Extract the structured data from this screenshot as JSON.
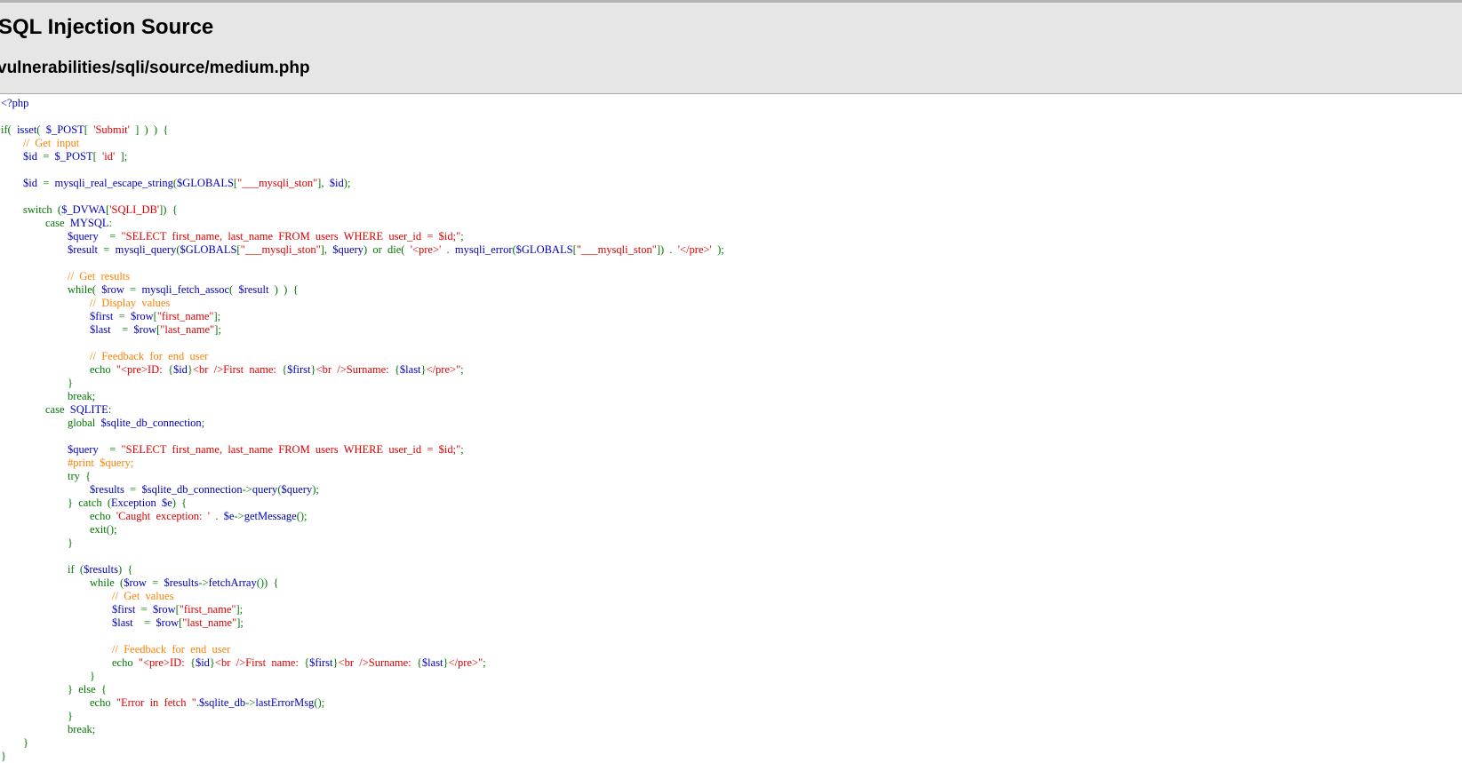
{
  "header": {
    "title": "SQL Injection Source",
    "subtitle": "vulnerabilities/sqli/source/medium.php"
  },
  "colors": {
    "header_bg": "#e6e6e6",
    "keyword": "#007700",
    "default": "#0000bb",
    "string": "#dd0000",
    "comment": "#ff8000"
  },
  "code_lines": [
    [
      {
        "t": "html",
        "v": "<?php"
      }
    ],
    [],
    [
      {
        "t": "keyword",
        "v": "if(  "
      },
      {
        "t": "default",
        "v": "isset"
      },
      {
        "t": "keyword",
        "v": "(  "
      },
      {
        "t": "default",
        "v": "$_POST"
      },
      {
        "t": "keyword",
        "v": "[  "
      },
      {
        "t": "string",
        "v": "'Submit'"
      },
      {
        "t": "keyword",
        "v": "  ]  )  )  {"
      }
    ],
    [
      {
        "t": "keyword",
        "v": "        "
      },
      {
        "t": "comment",
        "v": "//  Get  input"
      }
    ],
    [
      {
        "t": "keyword",
        "v": "        "
      },
      {
        "t": "default",
        "v": "$id  "
      },
      {
        "t": "keyword",
        "v": "=  "
      },
      {
        "t": "default",
        "v": "$_POST"
      },
      {
        "t": "keyword",
        "v": "[  "
      },
      {
        "t": "string",
        "v": "'id'"
      },
      {
        "t": "keyword",
        "v": "  ];"
      }
    ],
    [],
    [
      {
        "t": "keyword",
        "v": "        "
      },
      {
        "t": "default",
        "v": "$id  "
      },
      {
        "t": "keyword",
        "v": "=  "
      },
      {
        "t": "default",
        "v": "mysqli_real_escape_string"
      },
      {
        "t": "keyword",
        "v": "("
      },
      {
        "t": "default",
        "v": "$GLOBALS"
      },
      {
        "t": "keyword",
        "v": "["
      },
      {
        "t": "string",
        "v": "\"___mysqli_ston\""
      },
      {
        "t": "keyword",
        "v": "],  "
      },
      {
        "t": "default",
        "v": "$id"
      },
      {
        "t": "keyword",
        "v": ");"
      }
    ],
    [],
    [
      {
        "t": "keyword",
        "v": "        switch  ("
      },
      {
        "t": "default",
        "v": "$_DVWA"
      },
      {
        "t": "keyword",
        "v": "["
      },
      {
        "t": "string",
        "v": "'SQLI_DB'"
      },
      {
        "t": "keyword",
        "v": "])  {"
      }
    ],
    [
      {
        "t": "keyword",
        "v": "                case  "
      },
      {
        "t": "default",
        "v": "MYSQL"
      },
      {
        "t": "keyword",
        "v": ":"
      }
    ],
    [
      {
        "t": "keyword",
        "v": "                        "
      },
      {
        "t": "default",
        "v": "$query    "
      },
      {
        "t": "keyword",
        "v": "=  "
      },
      {
        "t": "string",
        "v": "\"SELECT  first_name,  last_name  FROM  users  WHERE  user_id  =  $id;\""
      },
      {
        "t": "keyword",
        "v": ";"
      }
    ],
    [
      {
        "t": "keyword",
        "v": "                        "
      },
      {
        "t": "default",
        "v": "$result  "
      },
      {
        "t": "keyword",
        "v": "=  "
      },
      {
        "t": "default",
        "v": "mysqli_query"
      },
      {
        "t": "keyword",
        "v": "("
      },
      {
        "t": "default",
        "v": "$GLOBALS"
      },
      {
        "t": "keyword",
        "v": "["
      },
      {
        "t": "string",
        "v": "\"___mysqli_ston\""
      },
      {
        "t": "keyword",
        "v": "],  "
      },
      {
        "t": "default",
        "v": "$query"
      },
      {
        "t": "keyword",
        "v": ")  or  die(  "
      },
      {
        "t": "string",
        "v": "'<pre>'  "
      },
      {
        "t": "keyword",
        "v": ".  "
      },
      {
        "t": "default",
        "v": "mysqli_error"
      },
      {
        "t": "keyword",
        "v": "("
      },
      {
        "t": "default",
        "v": "$GLOBALS"
      },
      {
        "t": "keyword",
        "v": "["
      },
      {
        "t": "string",
        "v": "\"___mysqli_ston\""
      },
      {
        "t": "keyword",
        "v": "])  .  "
      },
      {
        "t": "string",
        "v": "'</pre>'"
      },
      {
        "t": "keyword",
        "v": "  );"
      }
    ],
    [],
    [
      {
        "t": "keyword",
        "v": "                        "
      },
      {
        "t": "comment",
        "v": "//  Get  results"
      }
    ],
    [
      {
        "t": "keyword",
        "v": "                        while(  "
      },
      {
        "t": "default",
        "v": "$row  "
      },
      {
        "t": "keyword",
        "v": "=  "
      },
      {
        "t": "default",
        "v": "mysqli_fetch_assoc"
      },
      {
        "t": "keyword",
        "v": "(  "
      },
      {
        "t": "default",
        "v": "$result  "
      },
      {
        "t": "keyword",
        "v": ")  )  {"
      }
    ],
    [
      {
        "t": "keyword",
        "v": "                                "
      },
      {
        "t": "comment",
        "v": "//  Display  values"
      }
    ],
    [
      {
        "t": "keyword",
        "v": "                                "
      },
      {
        "t": "default",
        "v": "$first  "
      },
      {
        "t": "keyword",
        "v": "=  "
      },
      {
        "t": "default",
        "v": "$row"
      },
      {
        "t": "keyword",
        "v": "["
      },
      {
        "t": "string",
        "v": "\"first_name\""
      },
      {
        "t": "keyword",
        "v": "];"
      }
    ],
    [
      {
        "t": "keyword",
        "v": "                                "
      },
      {
        "t": "default",
        "v": "$last    "
      },
      {
        "t": "keyword",
        "v": "=  "
      },
      {
        "t": "default",
        "v": "$row"
      },
      {
        "t": "keyword",
        "v": "["
      },
      {
        "t": "string",
        "v": "\"last_name\""
      },
      {
        "t": "keyword",
        "v": "];"
      }
    ],
    [],
    [
      {
        "t": "keyword",
        "v": "                                "
      },
      {
        "t": "comment",
        "v": "//  Feedback  for  end  user"
      }
    ],
    [
      {
        "t": "keyword",
        "v": "                                echo  "
      },
      {
        "t": "string",
        "v": "\"<pre>ID:  "
      },
      {
        "t": "keyword",
        "v": "{"
      },
      {
        "t": "default",
        "v": "$id"
      },
      {
        "t": "keyword",
        "v": "}"
      },
      {
        "t": "string",
        "v": "<br  />First  name:  "
      },
      {
        "t": "keyword",
        "v": "{"
      },
      {
        "t": "default",
        "v": "$first"
      },
      {
        "t": "keyword",
        "v": "}"
      },
      {
        "t": "string",
        "v": "<br  />Surname:  "
      },
      {
        "t": "keyword",
        "v": "{"
      },
      {
        "t": "default",
        "v": "$last"
      },
      {
        "t": "keyword",
        "v": "}"
      },
      {
        "t": "string",
        "v": "</pre>\""
      },
      {
        "t": "keyword",
        "v": ";"
      }
    ],
    [
      {
        "t": "keyword",
        "v": "                        }"
      }
    ],
    [
      {
        "t": "keyword",
        "v": "                        break;"
      }
    ],
    [
      {
        "t": "keyword",
        "v": "                case  "
      },
      {
        "t": "default",
        "v": "SQLITE"
      },
      {
        "t": "keyword",
        "v": ":"
      }
    ],
    [
      {
        "t": "keyword",
        "v": "                        global  "
      },
      {
        "t": "default",
        "v": "$sqlite_db_connection"
      },
      {
        "t": "keyword",
        "v": ";"
      }
    ],
    [],
    [
      {
        "t": "keyword",
        "v": "                        "
      },
      {
        "t": "default",
        "v": "$query    "
      },
      {
        "t": "keyword",
        "v": "=  "
      },
      {
        "t": "string",
        "v": "\"SELECT  first_name,  last_name  FROM  users  WHERE  user_id  =  $id;\""
      },
      {
        "t": "keyword",
        "v": ";"
      }
    ],
    [
      {
        "t": "keyword",
        "v": "                        "
      },
      {
        "t": "comment",
        "v": "#print  $query;"
      }
    ],
    [
      {
        "t": "keyword",
        "v": "                        try  {"
      }
    ],
    [
      {
        "t": "keyword",
        "v": "                                "
      },
      {
        "t": "default",
        "v": "$results  "
      },
      {
        "t": "keyword",
        "v": "=  "
      },
      {
        "t": "default",
        "v": "$sqlite_db_connection"
      },
      {
        "t": "keyword",
        "v": "->"
      },
      {
        "t": "default",
        "v": "query"
      },
      {
        "t": "keyword",
        "v": "("
      },
      {
        "t": "default",
        "v": "$query"
      },
      {
        "t": "keyword",
        "v": ");"
      }
    ],
    [
      {
        "t": "keyword",
        "v": "                        }  catch  ("
      },
      {
        "t": "default",
        "v": "Exception  $e"
      },
      {
        "t": "keyword",
        "v": ")  {"
      }
    ],
    [
      {
        "t": "keyword",
        "v": "                                echo  "
      },
      {
        "t": "string",
        "v": "'Caught  exception:  '  "
      },
      {
        "t": "keyword",
        "v": ".  "
      },
      {
        "t": "default",
        "v": "$e"
      },
      {
        "t": "keyword",
        "v": "->"
      },
      {
        "t": "default",
        "v": "getMessage"
      },
      {
        "t": "keyword",
        "v": "();"
      }
    ],
    [
      {
        "t": "keyword",
        "v": "                                exit();"
      }
    ],
    [
      {
        "t": "keyword",
        "v": "                        }"
      }
    ],
    [],
    [
      {
        "t": "keyword",
        "v": "                        if  ("
      },
      {
        "t": "default",
        "v": "$results"
      },
      {
        "t": "keyword",
        "v": ")  {"
      }
    ],
    [
      {
        "t": "keyword",
        "v": "                                while  ("
      },
      {
        "t": "default",
        "v": "$row  "
      },
      {
        "t": "keyword",
        "v": "=  "
      },
      {
        "t": "default",
        "v": "$results"
      },
      {
        "t": "keyword",
        "v": "->"
      },
      {
        "t": "default",
        "v": "fetchArray"
      },
      {
        "t": "keyword",
        "v": "())  {"
      }
    ],
    [
      {
        "t": "keyword",
        "v": "                                        "
      },
      {
        "t": "comment",
        "v": "//  Get  values"
      }
    ],
    [
      {
        "t": "keyword",
        "v": "                                        "
      },
      {
        "t": "default",
        "v": "$first  "
      },
      {
        "t": "keyword",
        "v": "=  "
      },
      {
        "t": "default",
        "v": "$row"
      },
      {
        "t": "keyword",
        "v": "["
      },
      {
        "t": "string",
        "v": "\"first_name\""
      },
      {
        "t": "keyword",
        "v": "];"
      }
    ],
    [
      {
        "t": "keyword",
        "v": "                                        "
      },
      {
        "t": "default",
        "v": "$last    "
      },
      {
        "t": "keyword",
        "v": "=  "
      },
      {
        "t": "default",
        "v": "$row"
      },
      {
        "t": "keyword",
        "v": "["
      },
      {
        "t": "string",
        "v": "\"last_name\""
      },
      {
        "t": "keyword",
        "v": "];"
      }
    ],
    [],
    [
      {
        "t": "keyword",
        "v": "                                        "
      },
      {
        "t": "comment",
        "v": "//  Feedback  for  end  user"
      }
    ],
    [
      {
        "t": "keyword",
        "v": "                                        echo  "
      },
      {
        "t": "string",
        "v": "\"<pre>ID:  "
      },
      {
        "t": "keyword",
        "v": "{"
      },
      {
        "t": "default",
        "v": "$id"
      },
      {
        "t": "keyword",
        "v": "}"
      },
      {
        "t": "string",
        "v": "<br  />First  name:  "
      },
      {
        "t": "keyword",
        "v": "{"
      },
      {
        "t": "default",
        "v": "$first"
      },
      {
        "t": "keyword",
        "v": "}"
      },
      {
        "t": "string",
        "v": "<br  />Surname:  "
      },
      {
        "t": "keyword",
        "v": "{"
      },
      {
        "t": "default",
        "v": "$last"
      },
      {
        "t": "keyword",
        "v": "}"
      },
      {
        "t": "string",
        "v": "</pre>\""
      },
      {
        "t": "keyword",
        "v": ";"
      }
    ],
    [
      {
        "t": "keyword",
        "v": "                                }"
      }
    ],
    [
      {
        "t": "keyword",
        "v": "                        }  else  {"
      }
    ],
    [
      {
        "t": "keyword",
        "v": "                                echo  "
      },
      {
        "t": "string",
        "v": "\"Error  in  fetch  \""
      },
      {
        "t": "keyword",
        "v": "."
      },
      {
        "t": "default",
        "v": "$sqlite_db"
      },
      {
        "t": "keyword",
        "v": "->"
      },
      {
        "t": "default",
        "v": "lastErrorMsg"
      },
      {
        "t": "keyword",
        "v": "();"
      }
    ],
    [
      {
        "t": "keyword",
        "v": "                        }"
      }
    ],
    [
      {
        "t": "keyword",
        "v": "                        break;"
      }
    ],
    [
      {
        "t": "keyword",
        "v": "        }"
      }
    ],
    [
      {
        "t": "keyword",
        "v": "}"
      }
    ]
  ]
}
